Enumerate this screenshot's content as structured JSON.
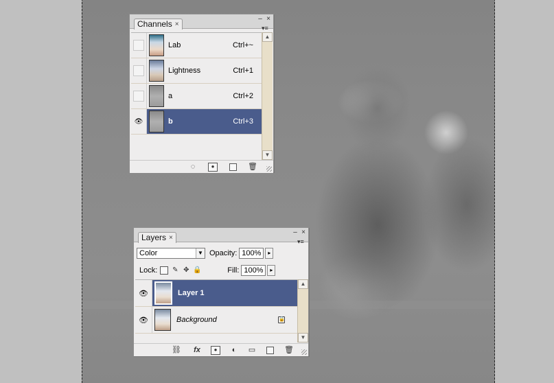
{
  "channels_panel": {
    "tab_label": "Channels",
    "tab_close": "×",
    "minimize": "–",
    "close": "×",
    "menu": "▾≡",
    "rows": [
      {
        "name": "Lab",
        "shortcut": "Ctrl+~",
        "visible": false,
        "selected": false,
        "thumb": "color"
      },
      {
        "name": "Lightness",
        "shortcut": "Ctrl+1",
        "visible": false,
        "selected": false,
        "thumb": "color"
      },
      {
        "name": "a",
        "shortcut": "Ctrl+2",
        "visible": false,
        "selected": false,
        "thumb": "gray"
      },
      {
        "name": "b",
        "shortcut": "Ctrl+3",
        "visible": true,
        "selected": true,
        "thumb": "gray"
      }
    ],
    "footer_icons": [
      "load-selection-icon",
      "save-selection-icon",
      "new-channel-icon",
      "trash-icon"
    ]
  },
  "layers_panel": {
    "tab_label": "Layers",
    "tab_close": "×",
    "minimize": "–",
    "close": "×",
    "menu": "▾≡",
    "blend_mode": "Color",
    "opacity_label": "Opacity:",
    "opacity_value": "100%",
    "lock_label": "Lock:",
    "fill_label": "Fill:",
    "fill_value": "100%",
    "layers": [
      {
        "name": "Layer 1",
        "visible": true,
        "selected": true,
        "locked": false
      },
      {
        "name": "Background",
        "visible": true,
        "selected": false,
        "locked": true
      }
    ],
    "footer_icons": [
      "link-icon",
      "fx-icon",
      "mask-icon",
      "adjustment-icon",
      "folder-icon",
      "new-layer-icon",
      "trash-icon"
    ],
    "fx_label": "fx"
  },
  "glyphs": {
    "eye": "👁",
    "up": "▲",
    "down": "▼",
    "flyout": "▸",
    "dropdown": "▼"
  },
  "colors": {
    "selection": "#4a5c8c",
    "panel_bg": "#eeeded",
    "scroll_track": "#e8dfc9"
  }
}
